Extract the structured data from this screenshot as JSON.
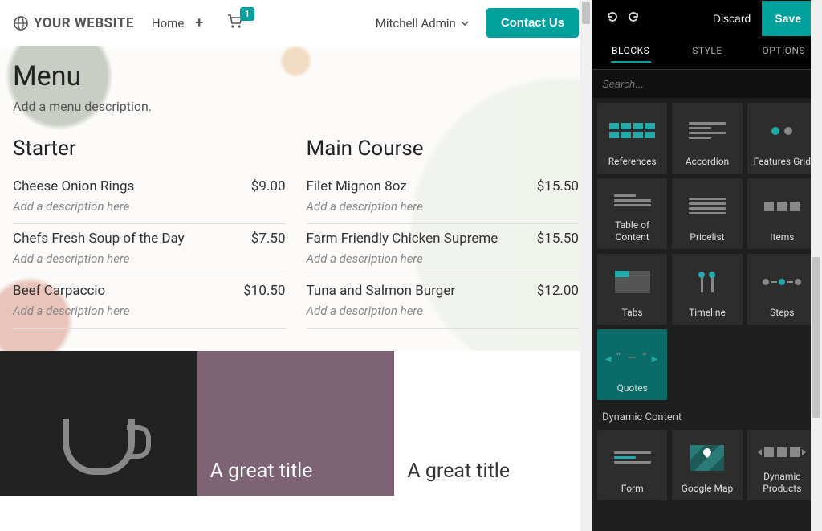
{
  "nav": {
    "brand": "YOUR WEBSITE",
    "home": "Home",
    "cart_count": "1",
    "user": "Mitchell Admin",
    "contact": "Contact Us"
  },
  "hero": {
    "title": "Menu",
    "subtitle": "Add a menu description."
  },
  "menu": {
    "col1": {
      "heading": "Starter",
      "items": [
        {
          "name": "Cheese Onion Rings",
          "price": "$9.00",
          "desc": "Add a description here"
        },
        {
          "name": "Chefs Fresh Soup of the Day",
          "price": "$7.50",
          "desc": "Add a description here"
        },
        {
          "name": "Beef Carpaccio",
          "price": "$10.50",
          "desc": "Add a description here"
        }
      ]
    },
    "col2": {
      "heading": "Main Course",
      "items": [
        {
          "name": "Filet Mignon 8oz",
          "price": "$15.50",
          "desc": "Add a description here"
        },
        {
          "name": "Farm Friendly Chicken Supreme",
          "price": "$15.50",
          "desc": "Add a description here"
        },
        {
          "name": "Tuna and Salmon Burger",
          "price": "$12.00",
          "desc": "Add a description here"
        }
      ]
    }
  },
  "tiles": {
    "t1": "A great title",
    "t2": "A great title"
  },
  "sidebar": {
    "discard": "Discard",
    "save": "Save",
    "tabs": {
      "blocks": "BLOCKS",
      "style": "STYLE",
      "options": "OPTIONS"
    },
    "search_placeholder": "Search...",
    "blocks": [
      "References",
      "Accordion",
      "Features Grid",
      "Table of Content",
      "Pricelist",
      "Items",
      "Tabs",
      "Timeline",
      "Steps",
      "Quotes"
    ],
    "section2": "Dynamic Content",
    "blocks2": [
      "Form",
      "Google Map",
      "Dynamic Products"
    ]
  }
}
